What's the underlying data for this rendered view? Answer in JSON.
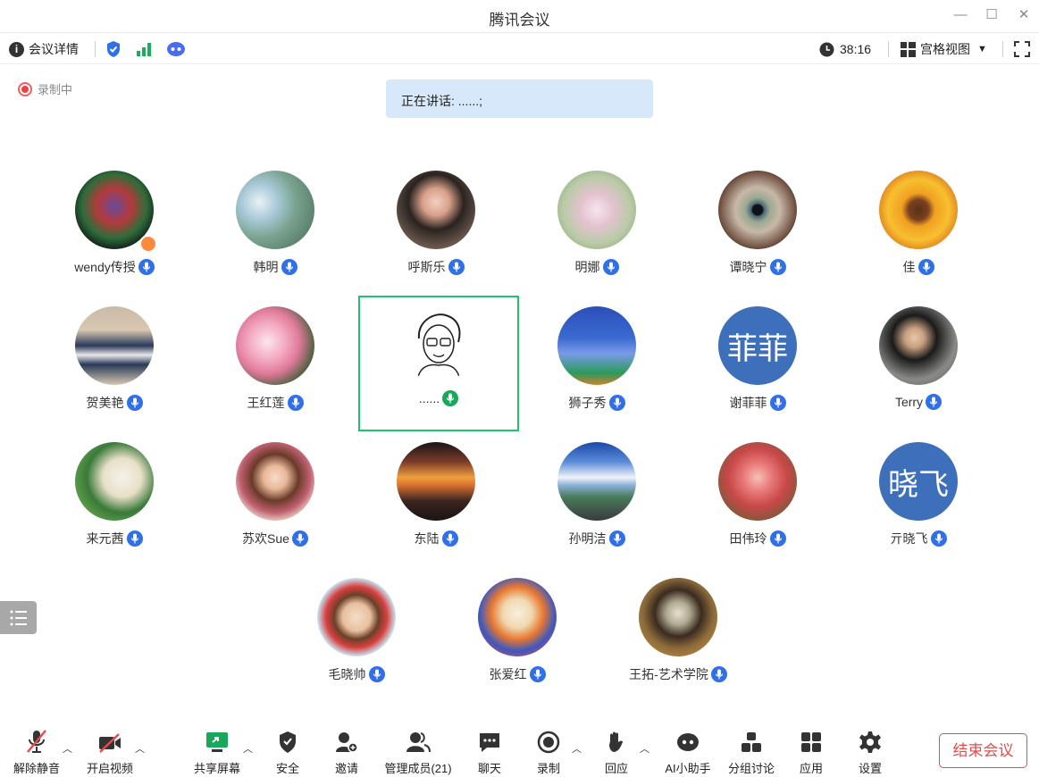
{
  "window": {
    "title": "腾讯会议"
  },
  "infobar": {
    "meeting_details": "会议详情",
    "duration": "38:16",
    "view_mode": "宫格视图"
  },
  "recording": {
    "label": "录制中"
  },
  "speaking": {
    "text": "正在讲话: ......;"
  },
  "participants": [
    {
      "name": "wendy传授"
    },
    {
      "name": "韩明"
    },
    {
      "name": "呼斯乐"
    },
    {
      "name": "明娜"
    },
    {
      "name": "谭晓宁"
    },
    {
      "name": "佳"
    },
    {
      "name": "贺美艳"
    },
    {
      "name": "王红莲"
    },
    {
      "name": "......"
    },
    {
      "name": "狮子秀"
    },
    {
      "name": "谢菲菲",
      "avatar_text": "菲菲"
    },
    {
      "name": "Terry"
    },
    {
      "name": "来元茜"
    },
    {
      "name": "苏欢Sue"
    },
    {
      "name": "东陆"
    },
    {
      "name": "孙明洁"
    },
    {
      "name": "田伟玲"
    },
    {
      "name": "亓晓飞",
      "avatar_text": "晓飞"
    },
    {
      "name": "毛晓帅"
    },
    {
      "name": "张爱红"
    },
    {
      "name": "王拓-艺术学院"
    }
  ],
  "toolbar": {
    "unmute": "解除静音",
    "start_video": "开启视频",
    "share_screen": "共享屏幕",
    "security": "安全",
    "invite": "邀请",
    "manage_members": "管理成员(21)",
    "chat": "聊天",
    "record": "录制",
    "react": "回应",
    "ai_assistant": "AI小助手",
    "breakout": "分组讨论",
    "apps": "应用",
    "settings": "设置",
    "end_meeting": "结束会议"
  },
  "colors": {
    "accent_blue": "#2f6fe8",
    "active_speaker_border": "#22c26a",
    "end_button": "#e84a4a",
    "speaking_bg": "#d8e8fb"
  }
}
